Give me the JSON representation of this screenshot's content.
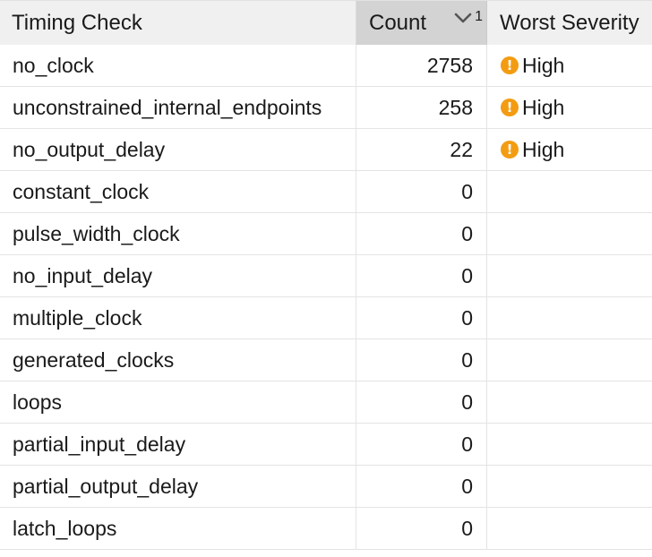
{
  "columns": {
    "timing_check": "Timing Check",
    "count": "Count",
    "worst_severity": "Worst Severity",
    "sort_index": "1"
  },
  "rows": [
    {
      "check": "no_clock",
      "count": "2758",
      "severity": "High"
    },
    {
      "check": "unconstrained_internal_endpoints",
      "count": "258",
      "severity": "High"
    },
    {
      "check": "no_output_delay",
      "count": "22",
      "severity": "High"
    },
    {
      "check": "constant_clock",
      "count": "0",
      "severity": ""
    },
    {
      "check": "pulse_width_clock",
      "count": "0",
      "severity": ""
    },
    {
      "check": "no_input_delay",
      "count": "0",
      "severity": ""
    },
    {
      "check": "multiple_clock",
      "count": "0",
      "severity": ""
    },
    {
      "check": "generated_clocks",
      "count": "0",
      "severity": ""
    },
    {
      "check": "loops",
      "count": "0",
      "severity": ""
    },
    {
      "check": "partial_input_delay",
      "count": "0",
      "severity": ""
    },
    {
      "check": "partial_output_delay",
      "count": "0",
      "severity": ""
    },
    {
      "check": "latch_loops",
      "count": "0",
      "severity": ""
    }
  ],
  "colors": {
    "severity_high": "#f39c12",
    "header_bg": "#f0f0f0",
    "sorted_header_bg": "#d3d3d3"
  },
  "icons": {
    "severity": "warning-circle-icon",
    "sort": "chevron-down-icon"
  }
}
